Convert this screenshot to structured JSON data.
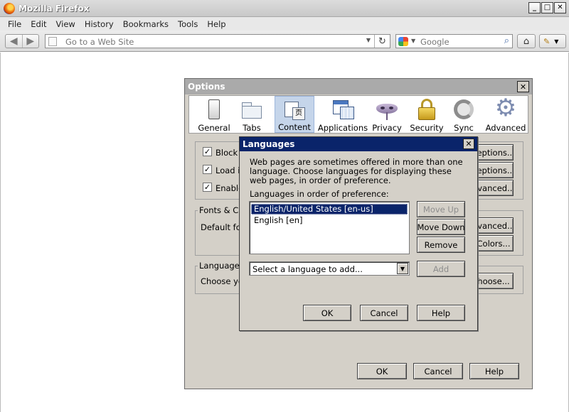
{
  "window": {
    "title": "Mozilla Firefox",
    "minimize": "_",
    "maximize": "□",
    "close": "✕"
  },
  "menu": {
    "items": [
      "File",
      "Edit",
      "View",
      "History",
      "Bookmarks",
      "Tools",
      "Help"
    ]
  },
  "navbar": {
    "url_placeholder": "Go to a Web Site",
    "search_placeholder": "Google"
  },
  "options": {
    "title": "Options",
    "close": "✕",
    "panes": [
      {
        "label": "General",
        "icon": "general-icon"
      },
      {
        "label": "Tabs",
        "icon": "tabs-icon"
      },
      {
        "label": "Content",
        "icon": "content-icon",
        "selected": true
      },
      {
        "label": "Applications",
        "icon": "applications-icon"
      },
      {
        "label": "Privacy",
        "icon": "privacy-mask-icon"
      },
      {
        "label": "Security",
        "icon": "padlock-icon"
      },
      {
        "label": "Sync",
        "icon": "sync-icon"
      },
      {
        "label": "Advanced",
        "icon": "gear-icon"
      }
    ],
    "checkboxes": [
      {
        "label": "Block p",
        "checked": true
      },
      {
        "label": "Load in",
        "checked": true
      },
      {
        "label": "Enable",
        "checked": true
      }
    ],
    "right_buttons": [
      "ceptions...",
      "ceptions...",
      "dvanced..."
    ],
    "fonts_group": {
      "legend": "Fonts & Col",
      "default_font": "Default font",
      "btn_advanced": "dvanced...",
      "btn_colors": "Colors..."
    },
    "languages_group": {
      "legend": "Languages",
      "choose_text": "Choose you",
      "btn_choose": "hoose..."
    },
    "ok": "OK",
    "cancel": "Cancel",
    "help": "Help"
  },
  "languages": {
    "title": "Languages",
    "close": "✕",
    "description": "Web pages are sometimes offered in more than one language. Choose languages for displaying these web pages, in order of preference.",
    "list_label": "Languages in order of preference:",
    "items": [
      {
        "label": "English/United States  [en-us]",
        "selected": true
      },
      {
        "label": "English  [en]",
        "selected": false
      }
    ],
    "move_up": "Move Up",
    "move_down": "Move Down",
    "remove": "Remove",
    "select_placeholder": "Select a language to add...",
    "add": "Add",
    "ok": "OK",
    "cancel": "Cancel",
    "help": "Help"
  }
}
